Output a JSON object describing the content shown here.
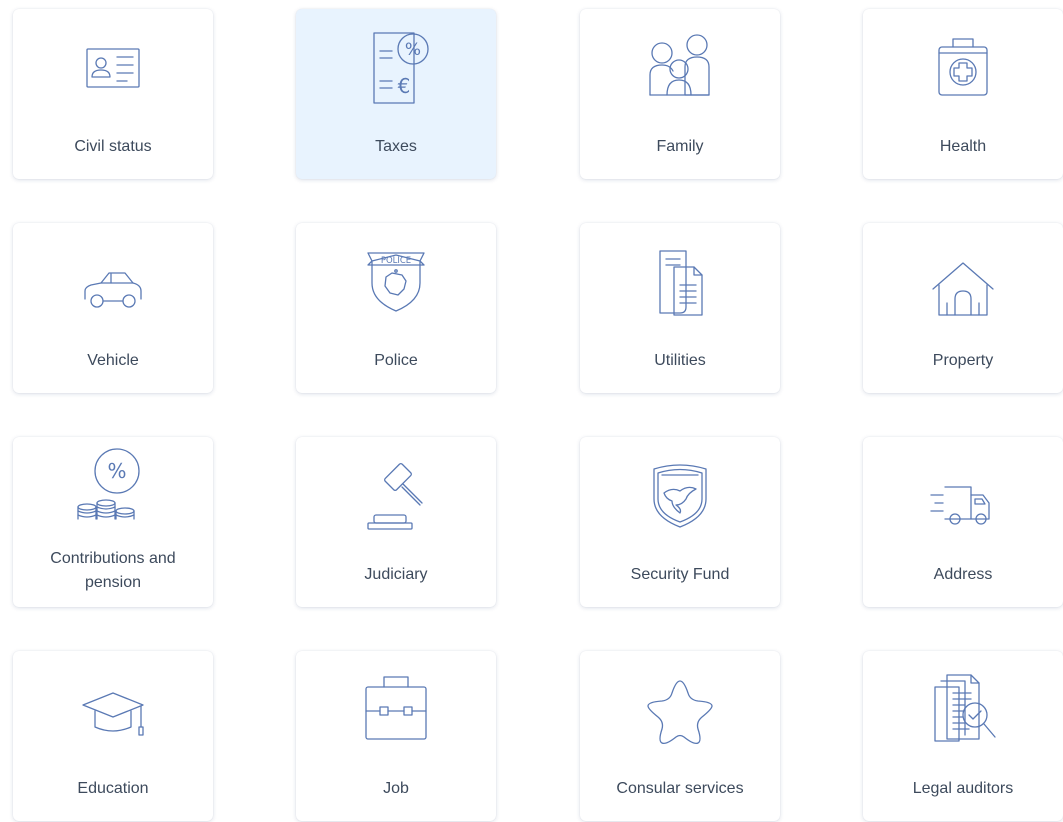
{
  "colors": {
    "icon_stroke": "#5a79b4",
    "label_text": "#3d4a5c",
    "active_card_bg": "#e8f3fe",
    "card_bg": "#ffffff"
  },
  "categories": [
    {
      "label": "Civil status",
      "icon": "id-card-icon",
      "active": false
    },
    {
      "label": "Taxes",
      "icon": "tax-document-icon",
      "active": true
    },
    {
      "label": "Family",
      "icon": "family-icon",
      "active": false
    },
    {
      "label": "Health",
      "icon": "medical-kit-icon",
      "active": false
    },
    {
      "label": "Vehicle",
      "icon": "car-icon",
      "active": false
    },
    {
      "label": "Police",
      "icon": "police-badge-icon",
      "active": false
    },
    {
      "label": "Utilities",
      "icon": "documents-icon",
      "active": false
    },
    {
      "label": "Property",
      "icon": "house-icon",
      "active": false
    },
    {
      "label": "Contributions and pension",
      "icon": "coins-percent-icon",
      "active": false
    },
    {
      "label": "Judiciary",
      "icon": "gavel-icon",
      "active": false
    },
    {
      "label": "Security Fund",
      "icon": "eagle-shield-icon",
      "active": false
    },
    {
      "label": "Address",
      "icon": "delivery-truck-icon",
      "active": false
    },
    {
      "label": "Education",
      "icon": "graduation-cap-icon",
      "active": false
    },
    {
      "label": "Job",
      "icon": "briefcase-icon",
      "active": false
    },
    {
      "label": "Consular services",
      "icon": "star-icon",
      "active": false
    },
    {
      "label": "Legal auditors",
      "icon": "document-search-icon",
      "active": false
    }
  ],
  "icon_text": {
    "percent": "%",
    "euro": "€",
    "police": "POLICE"
  }
}
